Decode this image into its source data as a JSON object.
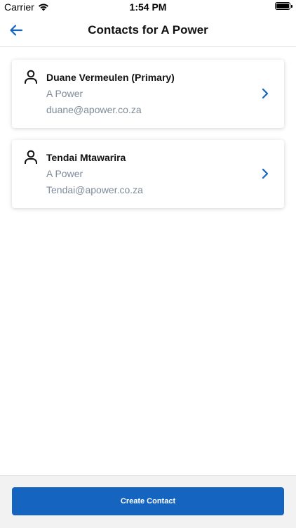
{
  "status_bar": {
    "carrier": "Carrier",
    "time": "1:54 PM",
    "icons": [
      "wifi-icon",
      "battery-icon"
    ]
  },
  "nav": {
    "back_icon": "arrow-left-icon",
    "title": "Contacts for A Power"
  },
  "contacts": [
    {
      "name": "Duane Vermeulen (Primary)",
      "company": "A Power",
      "email": "duane@apower.co.za",
      "icon": "person-icon"
    },
    {
      "name": "Tendai Mtawarira",
      "company": "A Power",
      "email": "Tendai@apower.co.za",
      "icon": "person-icon"
    }
  ],
  "footer": {
    "create_label": "Create Contact"
  },
  "colors": {
    "accent": "#1565c0",
    "secondary_text": "#7d8b99"
  }
}
